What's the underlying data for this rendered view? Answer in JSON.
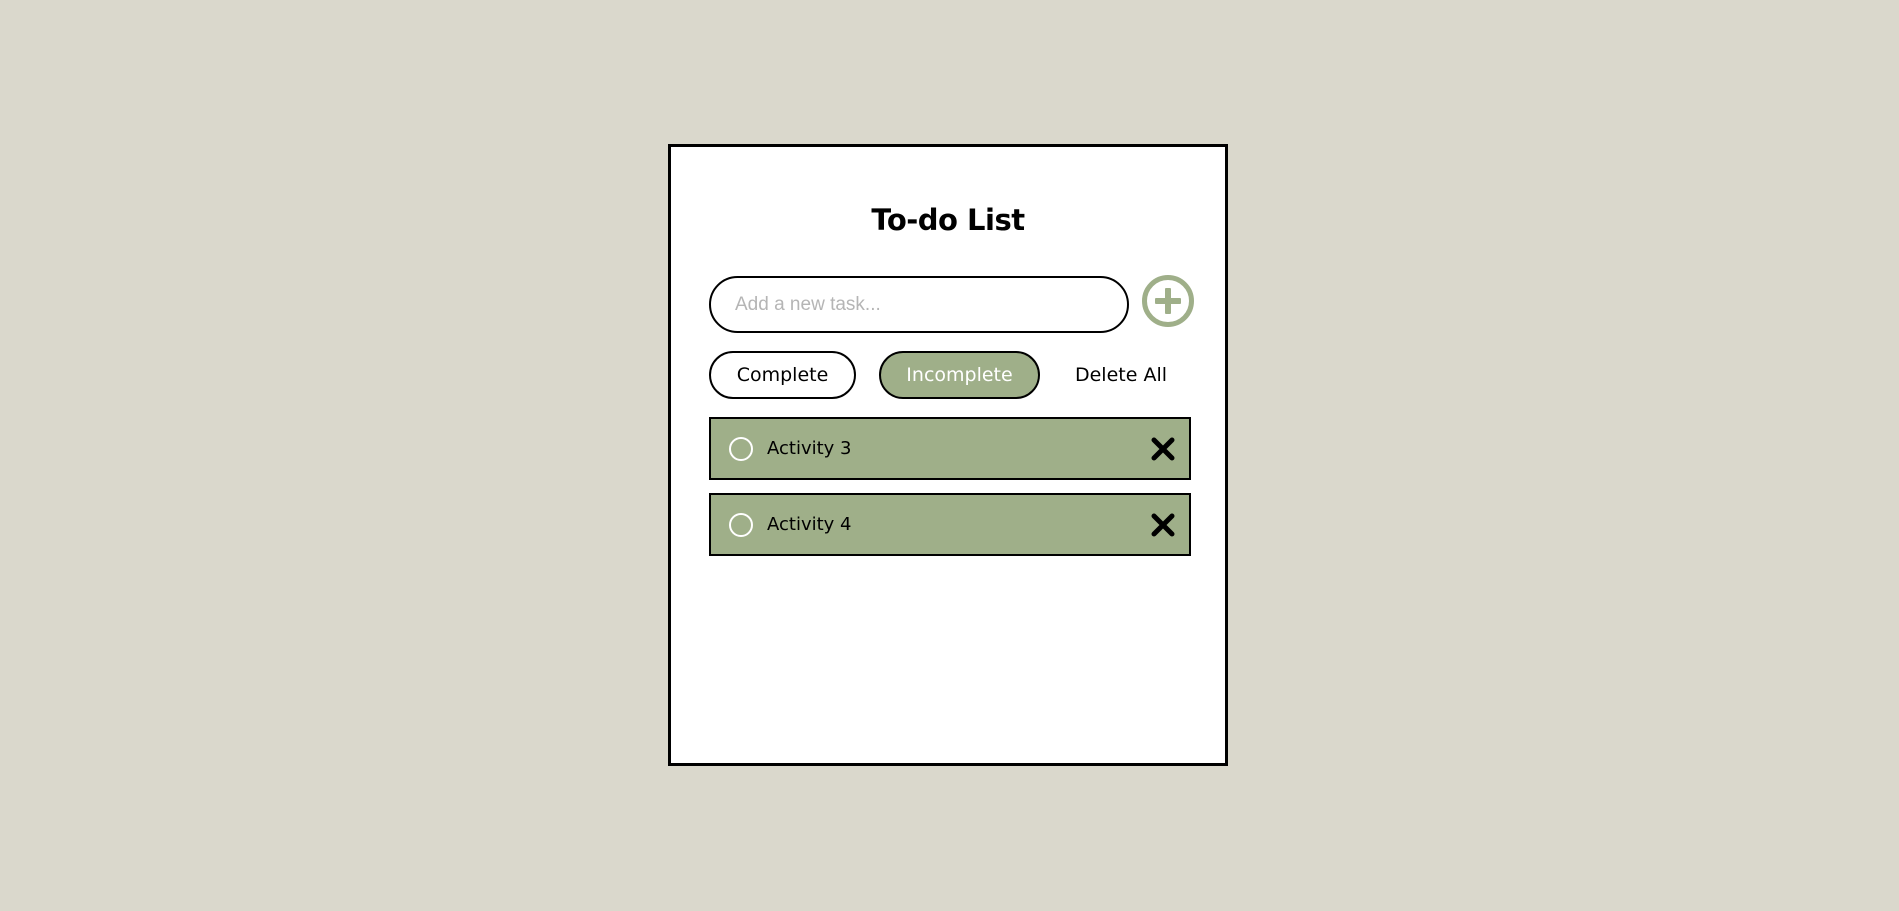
{
  "app": {
    "title": "To-do List"
  },
  "new_task": {
    "placeholder": "Add a new task...",
    "value": "",
    "add_icon": "plus-circle-icon"
  },
  "filters": {
    "complete_label": "Complete",
    "incomplete_label": "Incomplete",
    "delete_all_label": "Delete All",
    "active": "Incomplete"
  },
  "tasks": [
    {
      "label": "Activity 3",
      "completed": false,
      "check_icon": "circle-icon",
      "delete_icon": "close-icon"
    },
    {
      "label": "Activity 4",
      "completed": false,
      "check_icon": "circle-icon",
      "delete_icon": "close-icon"
    }
  ],
  "colors": {
    "page_background": "#dad8cc",
    "accent": "#9faf89",
    "card_background": "#ffffff",
    "border": "#000000"
  }
}
